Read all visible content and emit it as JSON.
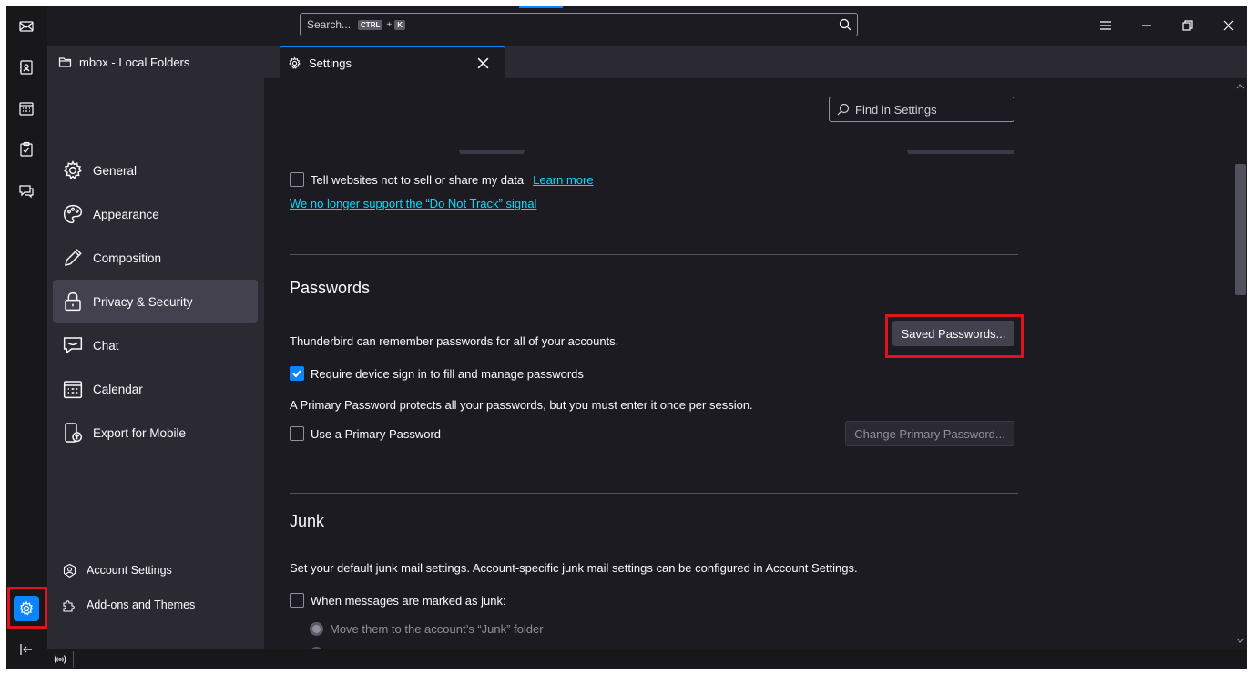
{
  "spaces": {
    "items": [
      {
        "name": "mail-icon"
      },
      {
        "name": "address-book-icon"
      },
      {
        "name": "calendar-icon"
      },
      {
        "name": "tasks-icon"
      },
      {
        "name": "chat-icon"
      }
    ],
    "settings_icon": "gear-icon",
    "collapse_icon": "collapse-left-icon"
  },
  "titlebar": {
    "search_placeholder": "Search...",
    "kbd_ctrl": "CTRL",
    "kbd_plus": "+",
    "kbd_k": "K"
  },
  "tabs": [
    {
      "label": "mbox - Local Folders",
      "icon": "folder-icon"
    },
    {
      "label": "Settings",
      "icon": "gear-icon"
    }
  ],
  "sidebar": {
    "categories": [
      {
        "label": "General",
        "icon": "gear-icon"
      },
      {
        "label": "Appearance",
        "icon": "palette-icon"
      },
      {
        "label": "Composition",
        "icon": "pencil-icon"
      },
      {
        "label": "Privacy & Security",
        "icon": "lock-icon",
        "selected": true
      },
      {
        "label": "Chat",
        "icon": "chat-icon"
      },
      {
        "label": "Calendar",
        "icon": "calendar-icon"
      },
      {
        "label": "Export for Mobile",
        "icon": "mobile-export-icon"
      }
    ],
    "footer": {
      "account_settings": "Account Settings",
      "addons": "Add-ons and Themes"
    }
  },
  "main": {
    "find_placeholder": "Find in Settings",
    "tracking": {
      "dont_sell_label": "Tell websites not to sell or share my data",
      "dont_sell_checked": false,
      "learn_more": "Learn more",
      "dnt_link": "We no longer support the “Do Not Track” signal"
    },
    "passwords": {
      "heading": "Passwords",
      "remember_text": "Thunderbird can remember passwords for all of your accounts.",
      "saved_button": "Saved Passwords...",
      "require_signin_label": "Require device sign in to fill and manage passwords",
      "require_signin_checked": true,
      "primary_info": "A Primary Password protects all your passwords, but you must enter it once per session.",
      "use_primary_label": "Use a Primary Password",
      "use_primary_checked": false,
      "change_primary_button": "Change Primary Password..."
    },
    "junk": {
      "heading": "Junk",
      "description": "Set your default junk mail settings. Account-specific junk mail settings can be configured in Account Settings.",
      "when_marked_label": "When messages are marked as junk:",
      "when_marked_checked": false,
      "move_option": "Move them to the account’s “Junk” folder"
    }
  },
  "colors": {
    "accent": "#0a84ff",
    "highlight_box": "#e1121f",
    "link": "#00ddff",
    "background": "#1c1b22",
    "sidebar": "#2b2a33"
  }
}
